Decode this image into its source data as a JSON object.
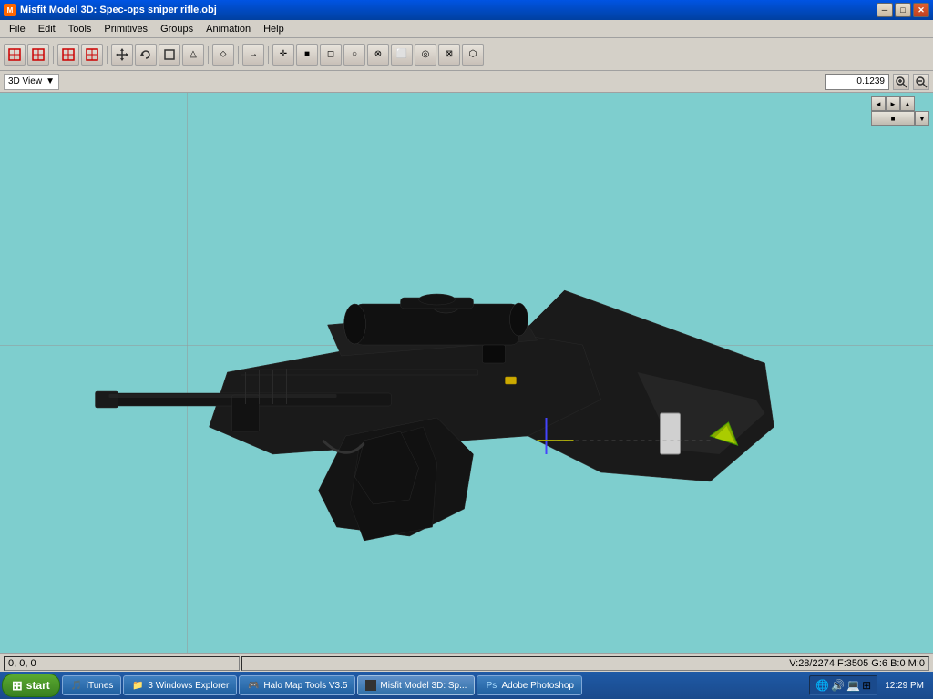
{
  "window": {
    "title": "Misfit Model 3D: Spec-ops sniper rifle.obj",
    "icon": "M"
  },
  "titlebar": {
    "minimize": "─",
    "maximize": "□",
    "close": "✕"
  },
  "menu": {
    "items": [
      "File",
      "Edit",
      "Tools",
      "Primitives",
      "Groups",
      "Animation",
      "Help"
    ]
  },
  "toolbar": {
    "tools": [
      {
        "name": "select-red1",
        "icon": "◈"
      },
      {
        "name": "select-red2",
        "icon": "◉"
      },
      {
        "name": "select-red3",
        "icon": "◆"
      },
      {
        "name": "select-orange",
        "icon": "⊞"
      },
      {
        "name": "move",
        "icon": "✛"
      },
      {
        "name": "rotate",
        "icon": "↺"
      },
      {
        "name": "scale-box",
        "icon": "□"
      },
      {
        "name": "tool1",
        "icon": "△"
      },
      {
        "name": "tool2",
        "icon": "⬦"
      },
      {
        "name": "tool3",
        "icon": "→"
      },
      {
        "name": "tool4",
        "icon": "✛"
      },
      {
        "name": "tool5",
        "icon": "■"
      },
      {
        "name": "tool6",
        "icon": "◻"
      },
      {
        "name": "tool7",
        "icon": "○"
      },
      {
        "name": "tool8",
        "icon": "⊗"
      },
      {
        "name": "tool9",
        "icon": "⬜"
      },
      {
        "name": "tool10",
        "icon": "◎"
      },
      {
        "name": "tool11",
        "icon": "⊠"
      },
      {
        "name": "tool12",
        "icon": "⬡"
      }
    ]
  },
  "viewbar": {
    "view_label": "3D View",
    "zoom_value": "0.1239",
    "zoom_in_icon": "+",
    "zoom_out_icon": "−"
  },
  "viewport": {
    "background_color": "#7ecece",
    "model_name": "Spec-ops sniper rifle"
  },
  "nav_buttons": {
    "left": "◄",
    "right": "►",
    "up": "▲",
    "center": "■",
    "down": "▼"
  },
  "statusbar": {
    "coords": "0, 0, 0",
    "info": "V:28/2274  F:3505  G:6  B:0  M:0"
  },
  "taskbar": {
    "start_label": "start",
    "clock": "12:29 PM",
    "tasks": [
      {
        "label": "iTunes",
        "icon": "🎵",
        "active": false
      },
      {
        "label": "3 Windows Explorer",
        "icon": "📁",
        "active": false
      },
      {
        "label": "Halo Map Tools V3.5",
        "icon": "🎮",
        "active": false
      },
      {
        "label": "Misfit Model 3D: Sp...",
        "icon": "⬛",
        "active": true
      },
      {
        "label": "Adobe Photoshop",
        "icon": "🔷",
        "active": false
      }
    ],
    "tray_icons": [
      "🔊",
      "🌐",
      "💻"
    ]
  }
}
